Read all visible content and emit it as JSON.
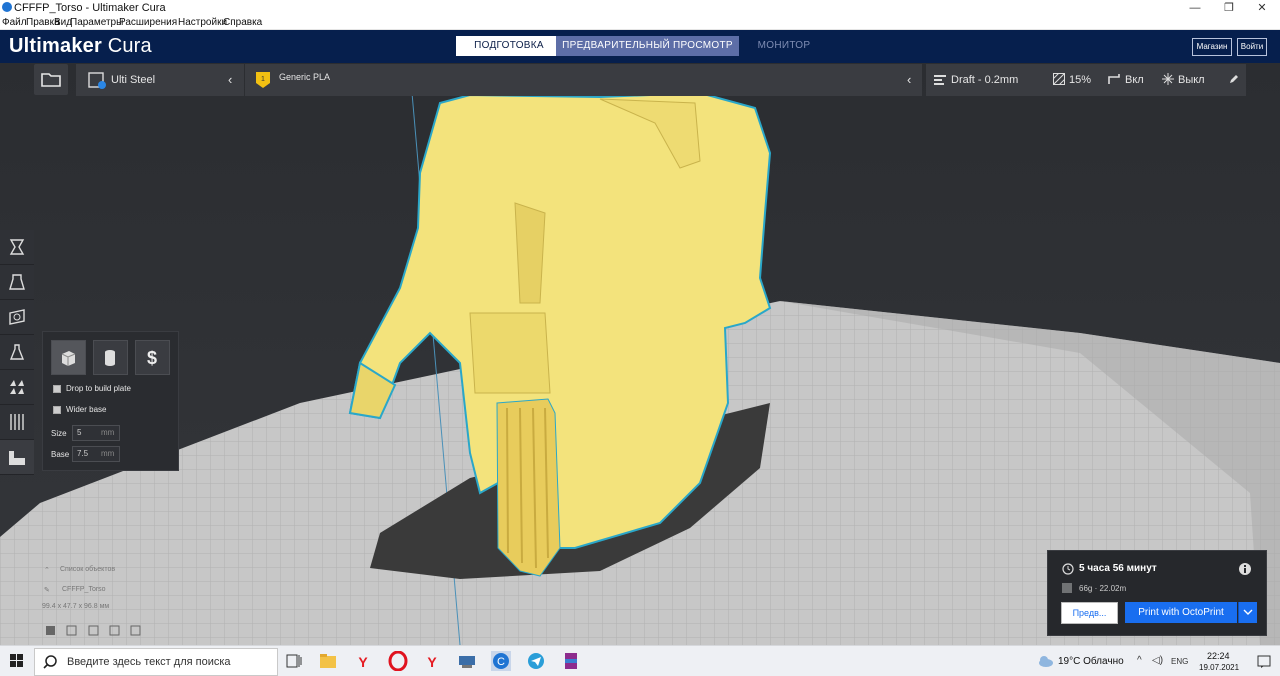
{
  "window": {
    "title": "CFFFP_Torso - Ultimaker Cura",
    "minimize": "—",
    "maximize": "❐",
    "close": "✕"
  },
  "menu": [
    "Файл",
    "Правка",
    "Вид",
    "Параметры",
    "Расширения",
    "Настройки",
    "Справка"
  ],
  "header": {
    "brand_bold": "Ultimaker",
    "brand_light": "Cura",
    "stages": {
      "prepare": "ПОДГОТОВКА",
      "preview": "ПРЕДВАРИТЕЛЬНЫЙ ПРОСМОТР",
      "monitor": "МОНИТОР"
    },
    "marketplace": "Магазин",
    "signin": "Войти"
  },
  "printer": {
    "name": "Ulti Steel"
  },
  "material": {
    "name": "Generic PLA"
  },
  "settings": {
    "profile": "Draft - 0.2mm",
    "infill": "15%",
    "support": "Вкл",
    "adhesion": "Выкл"
  },
  "support_panel": {
    "drop_to_build_plate": "Drop to build plate",
    "wider_base": "Wider base",
    "size_label": "Size",
    "size_value": "5",
    "size_unit": "mm",
    "base_label": "Base",
    "base_value": "7.5",
    "base_unit": "mm"
  },
  "objects": {
    "list_label": "Список объектов",
    "object_name": "CFFFP_Torso",
    "dimensions": "99.4 x 47.7 x 96.8 мм"
  },
  "estimate": {
    "time": "5 часа 56 минут",
    "material": "66g · 22.02m",
    "preview_button": "Предв...",
    "print_button": "Print with OctoPrint"
  },
  "taskbar": {
    "search_placeholder": "Введите здесь текст для поиска",
    "weather": "19°C  Облачно",
    "language": "ENG",
    "time": "22:24",
    "date": "19.07.2021"
  },
  "colors": {
    "header": "#061f4d",
    "model": "#f3e37c",
    "accent": "#196ef0"
  }
}
